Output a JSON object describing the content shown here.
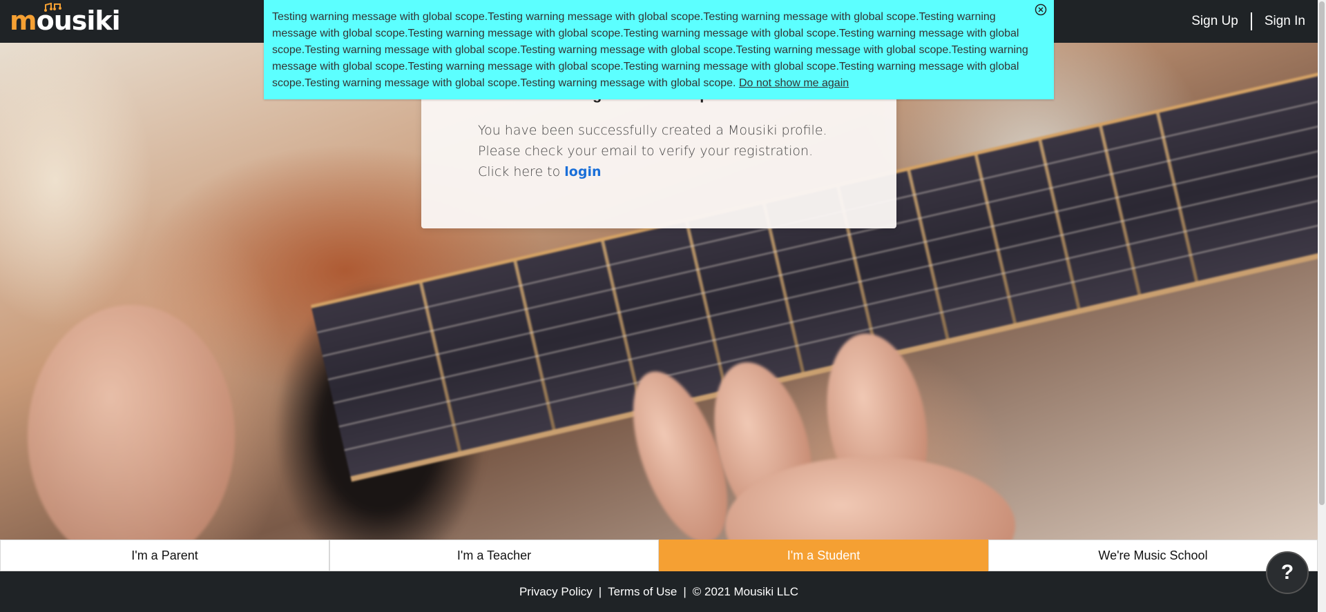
{
  "header": {
    "logo_text": "mousiki",
    "signup_label": "Sign Up",
    "signin_label": "Sign In"
  },
  "banner": {
    "message": "Testing warning message with global scope.Testing warning message with global scope.Testing warning message with global scope.Testing warning message with global scope.Testing warning message with global scope.Testing warning message with global scope.Testing warning message with global scope.Testing warning message with global scope.Testing warning message with global scope.Testing warning message with global scope.Testing warning message with global scope.Testing warning message with global scope.Testing warning message with global scope.Testing warning message with global scope.Testing warning message with global scope.Testing warning message with global scope.",
    "dismiss_label": "Do not show me again",
    "close_icon": "close-circle-icon",
    "background_color": "#5cffff"
  },
  "card": {
    "title": "Registration Completed",
    "message": "You have been successfully created a Mousiki profile. Please check your email to verify your registration. Click here to",
    "login_label": "login"
  },
  "tabs": [
    {
      "label": "I'm a Parent",
      "active": false
    },
    {
      "label": "I'm a Teacher",
      "active": false
    },
    {
      "label": "I'm a Student",
      "active": true
    },
    {
      "label": "We're Music School",
      "active": false
    }
  ],
  "footer": {
    "privacy_label": "Privacy Policy",
    "sep1": "|",
    "terms_label": "Terms of Use",
    "sep2": "|",
    "copyright": "© 2021 Mousiki LLC"
  },
  "help": {
    "label": "?",
    "icon": "help-icon"
  },
  "colors": {
    "accent": "#f5a033",
    "dark": "#1f2326",
    "link": "#1a6fd8"
  }
}
